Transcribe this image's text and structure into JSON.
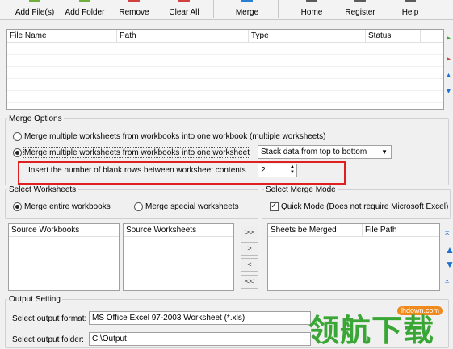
{
  "toolbar": {
    "add_files": "Add File(s)",
    "add_folder": "Add Folder",
    "remove": "Remove",
    "clear_all": "Clear All",
    "merge": "Merge",
    "home": "Home",
    "register": "Register",
    "help": "Help"
  },
  "file_list": {
    "columns": [
      "File Name",
      "Path",
      "Type",
      "Status"
    ]
  },
  "merge_options": {
    "legend": "Merge Options",
    "option1": "Merge multiple worksheets from workbooks into one workbook (multiple worksheets)",
    "option2": "Merge multiple worksheets from workbooks into one worksheet",
    "stack_mode": "Stack data from top to bottom",
    "blank_rows_label": "Insert the number of blank rows between worksheet contents",
    "blank_rows_value": "2",
    "selected": 2
  },
  "select_worksheets": {
    "legend": "Select Worksheets",
    "entire": "Merge entire workbooks",
    "special": "Merge special worksheets"
  },
  "select_merge_mode": {
    "legend": "Select Merge Mode",
    "quick_mode": "Quick Mode (Does not require Microsoft Excel)"
  },
  "lists": {
    "source_workbooks": "Source Workbooks",
    "source_worksheets": "Source Worksheets",
    "sheets_merged": "Sheets be Merged",
    "file_path": "File Path"
  },
  "move_buttons": [
    ">>",
    ">",
    "<",
    "<<"
  ],
  "output": {
    "legend": "Output Setting",
    "format_label": "Select output format:",
    "format_value": "MS Office Excel 97-2003 Worksheet (*.xls)",
    "folder_label": "Select output folder:",
    "folder_value": "C:\\Output"
  },
  "watermark": {
    "text": "领航下载",
    "site": "lhdown.com"
  },
  "colors": {
    "highlight": "#e02020",
    "accent": "#1e6fd0",
    "watermark_green": "#3aa635",
    "watermark_orange": "#f08a1c"
  }
}
